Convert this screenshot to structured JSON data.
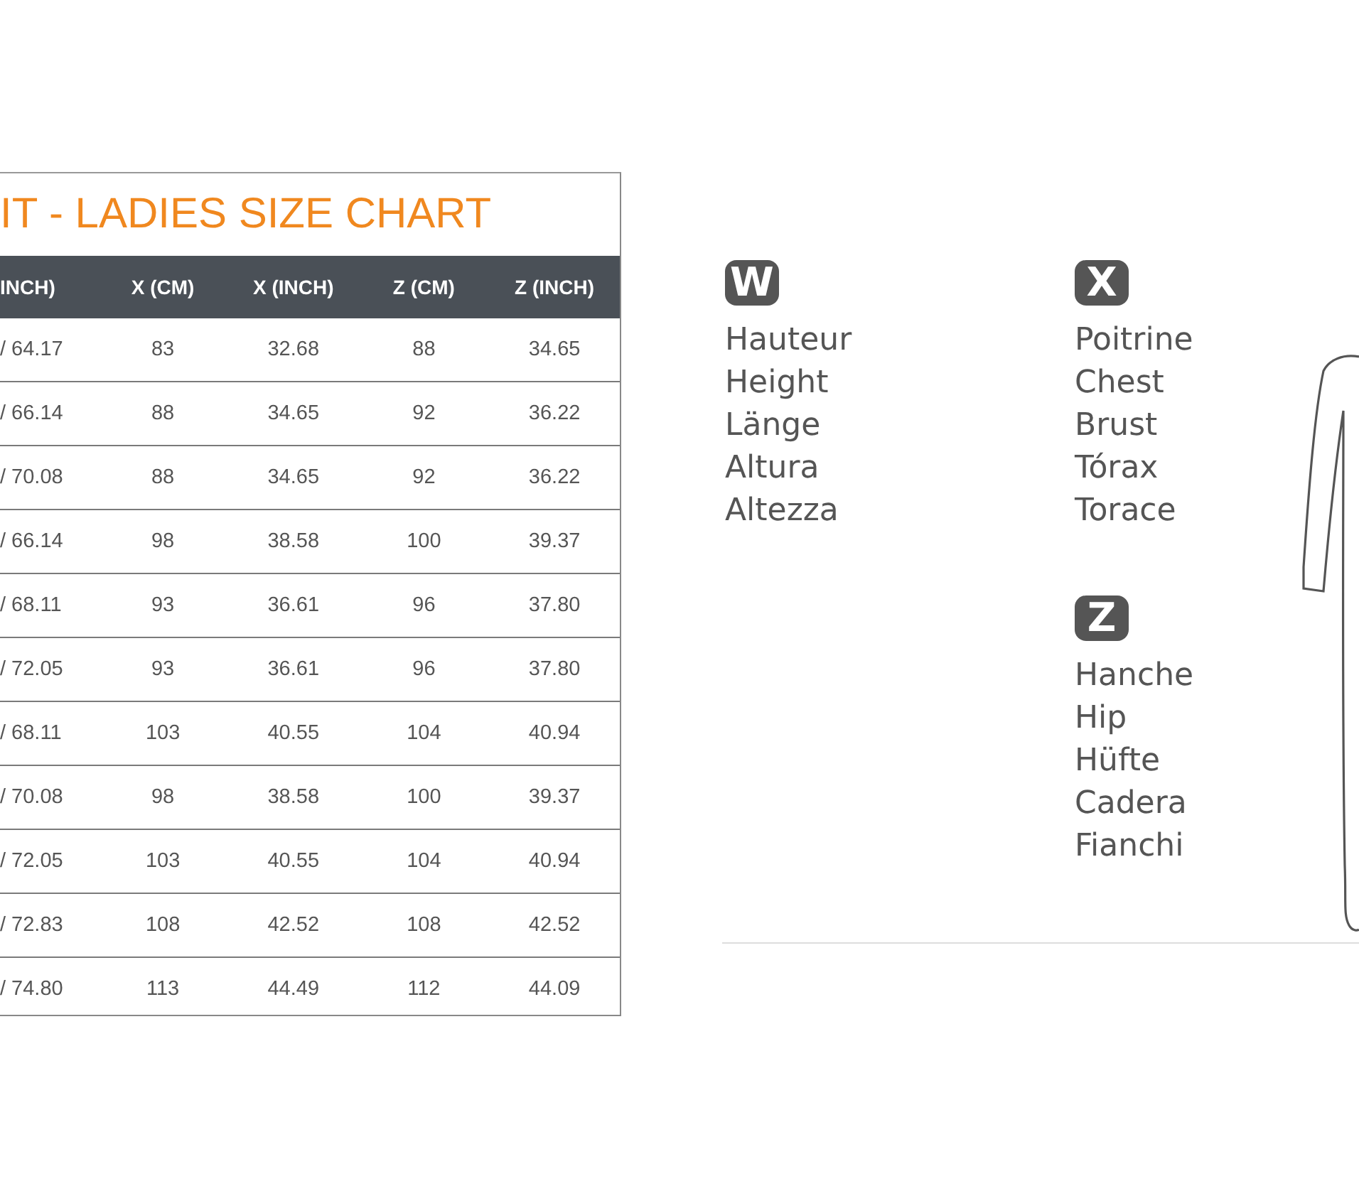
{
  "chart": {
    "title": "IT - LADIES SIZE CHART",
    "columns": [
      "INCH)",
      "X (CM)",
      "X (INCH)",
      "Z (CM)",
      "Z (INCH)"
    ],
    "rows": [
      [
        "/ 64.17",
        "83",
        "32.68",
        "88",
        "34.65"
      ],
      [
        "/ 66.14",
        "88",
        "34.65",
        "92",
        "36.22"
      ],
      [
        "/ 70.08",
        "88",
        "34.65",
        "92",
        "36.22"
      ],
      [
        "/ 66.14",
        "98",
        "38.58",
        "100",
        "39.37"
      ],
      [
        "/ 68.11",
        "93",
        "36.61",
        "96",
        "37.80"
      ],
      [
        "/ 72.05",
        "93",
        "36.61",
        "96",
        "37.80"
      ],
      [
        "/ 68.11",
        "103",
        "40.55",
        "104",
        "40.94"
      ],
      [
        "/ 70.08",
        "98",
        "38.58",
        "100",
        "39.37"
      ],
      [
        "/ 72.05",
        "103",
        "40.55",
        "104",
        "40.94"
      ],
      [
        "/ 72.83",
        "108",
        "42.52",
        "108",
        "42.52"
      ],
      [
        "/ 74.80",
        "113",
        "44.49",
        "112",
        "44.09"
      ]
    ]
  },
  "legend": [
    {
      "badge": "W",
      "labels": [
        "Hauteur",
        "Height",
        "Länge",
        "Altura",
        "Altezza"
      ]
    },
    {
      "badge": "X",
      "labels": [
        "Poitrine",
        "Chest",
        "Brust",
        "Tórax",
        "Torace"
      ]
    },
    {
      "badge": "Z",
      "labels": [
        "Hanche",
        "Hip",
        "Hüfte",
        "Cadera",
        "Fianchi"
      ]
    }
  ]
}
